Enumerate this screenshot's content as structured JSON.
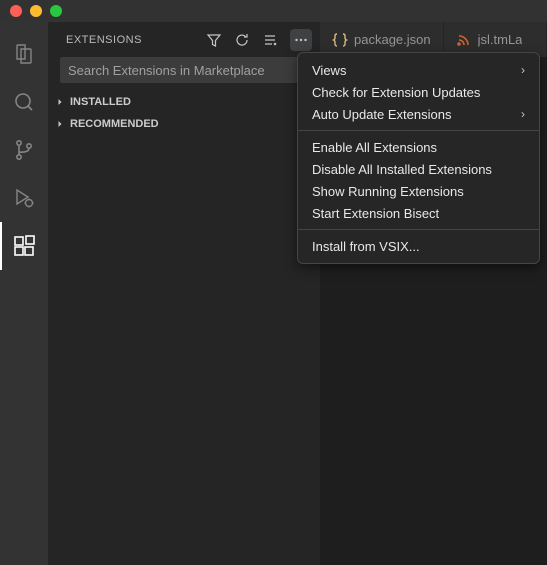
{
  "sidebar": {
    "title": "EXTENSIONS",
    "search_placeholder": "Search Extensions in Marketplace",
    "sections": {
      "installed": "INSTALLED",
      "recommended": "RECOMMENDED"
    }
  },
  "tabs": [
    {
      "label": "package.json",
      "icon": "braces",
      "color": "#d7ba7d"
    },
    {
      "label": "jsl.tmLa",
      "icon": "rss",
      "color": "#cc6633"
    }
  ],
  "menu": {
    "views": "Views",
    "check_updates": "Check for Extension Updates",
    "auto_update": "Auto Update Extensions",
    "enable_all": "Enable All Extensions",
    "disable_all": "Disable All Installed Extensions",
    "show_running": "Show Running Extensions",
    "start_bisect": "Start Extension Bisect",
    "install_vsix": "Install from VSIX..."
  }
}
